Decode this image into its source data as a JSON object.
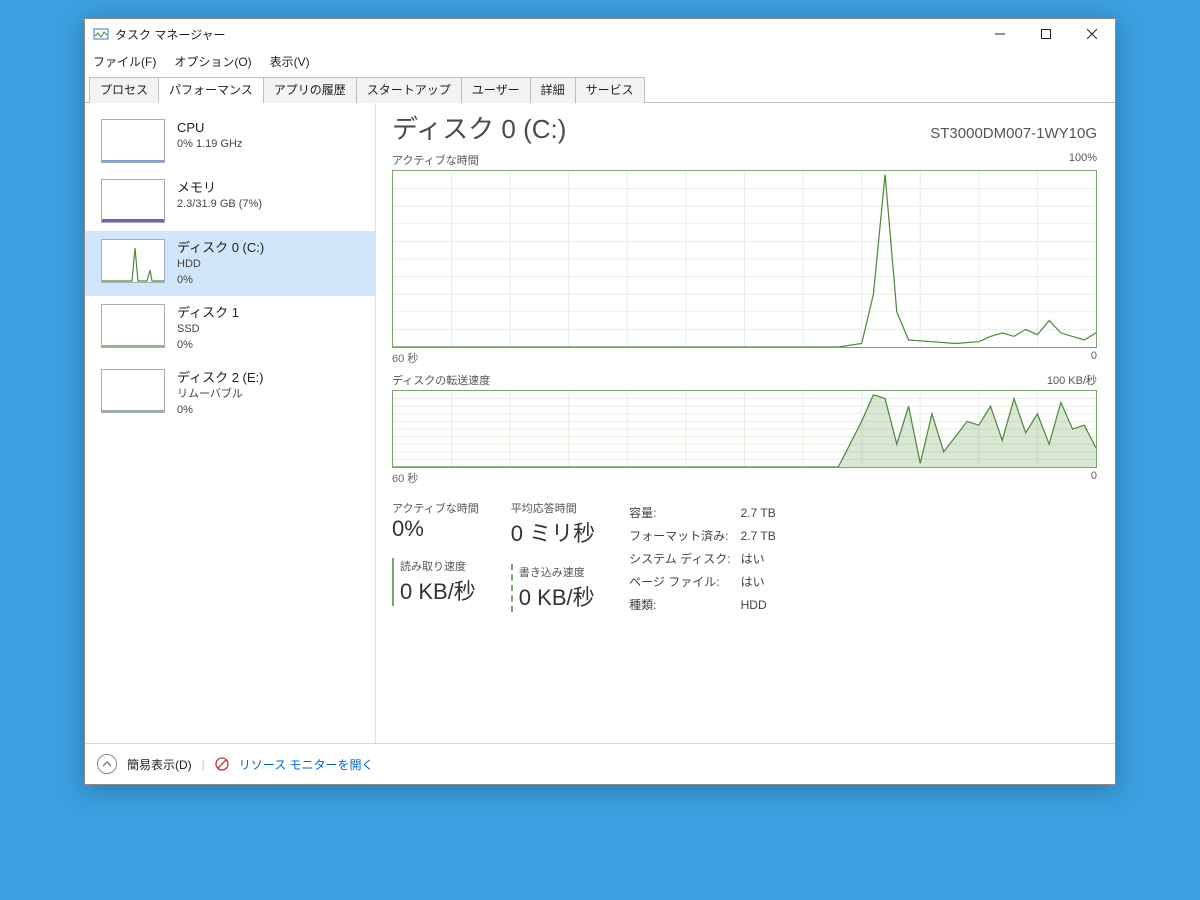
{
  "window": {
    "title": "タスク マネージャー"
  },
  "menu": {
    "file": "ファイル(F)",
    "options": "オプション(O)",
    "view": "表示(V)"
  },
  "tabs": [
    "プロセス",
    "パフォーマンス",
    "アプリの履歴",
    "スタートアップ",
    "ユーザー",
    "詳細",
    "サービス"
  ],
  "active_tab_index": 1,
  "sidebar": [
    {
      "title": "CPU",
      "sub": "0%  1.19 GHz"
    },
    {
      "title": "メモリ",
      "sub": "2.3/31.9 GB (7%)"
    },
    {
      "title": "ディスク 0 (C:)",
      "sub": "HDD\n0%"
    },
    {
      "title": "ディスク 1",
      "sub": "SSD\n0%"
    },
    {
      "title": "ディスク 2 (E:)",
      "sub": "リムーバブル\n0%"
    }
  ],
  "selected_sidebar_index": 2,
  "main": {
    "title": "ディスク 0 (C:)",
    "model": "ST3000DM007-1WY10G",
    "chart1": {
      "label": "アクティブな時間",
      "ymax": "100%",
      "xleft": "60 秒",
      "xright": "0"
    },
    "chart2": {
      "label": "ディスクの転送速度",
      "ymax": "100 KB/秒",
      "xleft": "60 秒",
      "xright": "0"
    },
    "stats": {
      "active_label": "アクティブな時間",
      "active_value": "0%",
      "avg_label": "平均応答時間",
      "avg_value": "0 ミリ秒",
      "read_label": "読み取り速度",
      "read_value": "0 KB/秒",
      "write_label": "書き込み速度",
      "write_value": "0 KB/秒"
    },
    "info": {
      "capacity_l": "容量:",
      "capacity_v": "2.7 TB",
      "formatted_l": "フォーマット済み:",
      "formatted_v": "2.7 TB",
      "sysdisk_l": "システム ディスク:",
      "sysdisk_v": "はい",
      "pagefile_l": "ページ ファイル:",
      "pagefile_v": "はい",
      "type_l": "種類:",
      "type_v": "HDD"
    }
  },
  "footer": {
    "fewer": "簡易表示(D)",
    "resmon": "リソース モニターを開く"
  },
  "chart_data": [
    {
      "type": "line",
      "title": "アクティブな時間",
      "xlabel": "秒",
      "ylabel": "%",
      "xlim": [
        0,
        60
      ],
      "ylim": [
        0,
        100
      ],
      "x": [
        60,
        58,
        56,
        54,
        52,
        50,
        48,
        46,
        44,
        42,
        40,
        38,
        36,
        34,
        32,
        30,
        28,
        26,
        24,
        22,
        20,
        19,
        18,
        17,
        16,
        14,
        12,
        10,
        9,
        8,
        7,
        6,
        5,
        4,
        3,
        2,
        1,
        0
      ],
      "values": [
        0,
        0,
        0,
        0,
        0,
        0,
        0,
        0,
        0,
        0,
        0,
        0,
        0,
        0,
        0,
        0,
        0,
        0,
        0,
        0,
        2,
        30,
        98,
        20,
        4,
        3,
        2,
        3,
        6,
        8,
        6,
        10,
        7,
        15,
        8,
        6,
        4,
        8
      ]
    },
    {
      "type": "area",
      "title": "ディスクの転送速度",
      "xlabel": "秒",
      "ylabel": "KB/秒",
      "xlim": [
        0,
        60
      ],
      "ylim": [
        0,
        100
      ],
      "x": [
        60,
        58,
        56,
        54,
        52,
        50,
        48,
        46,
        44,
        42,
        40,
        38,
        36,
        34,
        32,
        30,
        28,
        26,
        24,
        22,
        20,
        19,
        18,
        17,
        16,
        15,
        14,
        13,
        12,
        11,
        10,
        9,
        8,
        7,
        6,
        5,
        4,
        3,
        2,
        1,
        0
      ],
      "values": [
        0,
        0,
        0,
        0,
        0,
        0,
        0,
        0,
        0,
        0,
        0,
        0,
        0,
        0,
        0,
        0,
        0,
        0,
        0,
        0,
        60,
        95,
        90,
        30,
        80,
        5,
        70,
        20,
        40,
        60,
        55,
        80,
        35,
        90,
        45,
        70,
        30,
        85,
        50,
        55,
        25
      ]
    }
  ]
}
